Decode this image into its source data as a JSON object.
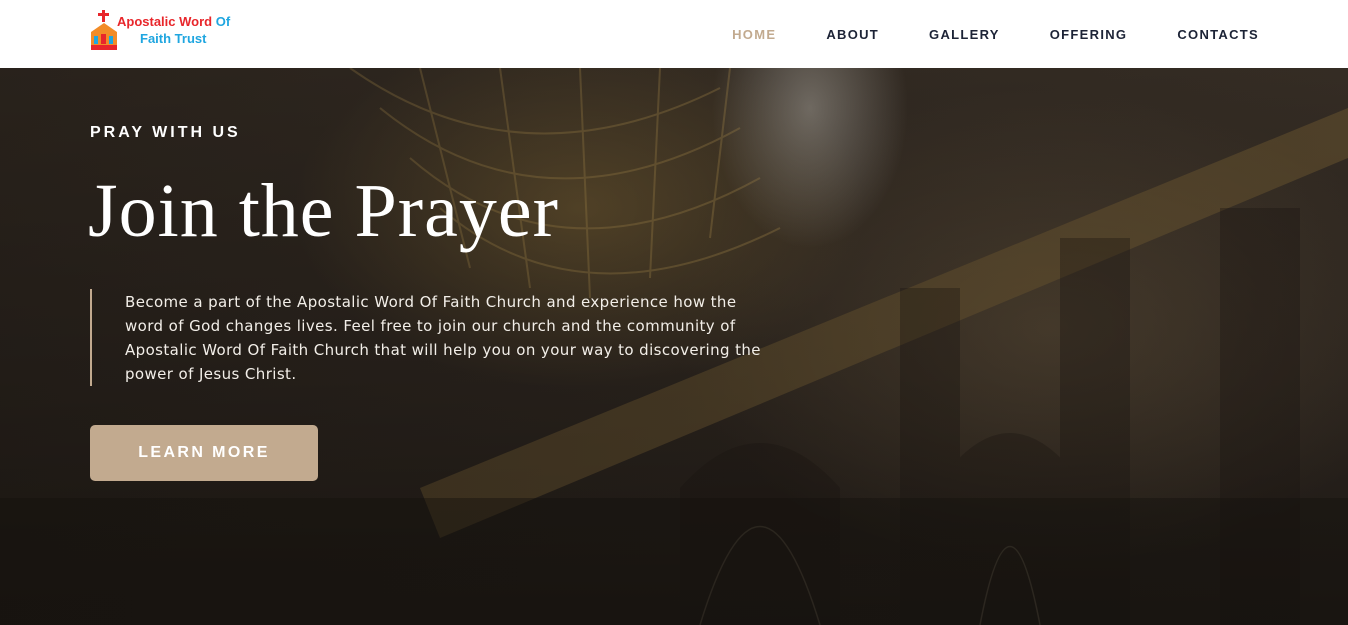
{
  "brand": {
    "line1": "Apostalic Word",
    "line1_of": "Of",
    "line2": "Faith Trust",
    "colors": {
      "red": "#e8262b",
      "blue": "#1fa6e0",
      "orange": "#f28c28"
    }
  },
  "nav": {
    "items": [
      {
        "label": "HOME",
        "active": true
      },
      {
        "label": "ABOUT",
        "active": false
      },
      {
        "label": "GALLERY",
        "active": false
      },
      {
        "label": "OFFERING",
        "active": false
      },
      {
        "label": "CONTACTS",
        "active": false
      }
    ],
    "active_color": "#c2aa8f",
    "text_color": "#1c2336"
  },
  "hero": {
    "eyebrow": "PRAY WITH US",
    "title": "Join the Prayer",
    "description": "Become a part of the Apostalic Word Of Faith Church and experience how the word of God changes lives. Feel free to join our church and the community of Apostalic Word Of Faith Church that will help you on your way to discovering the power of Jesus Christ.",
    "cta_label": "LEARN MORE",
    "accent": "#c2aa8f",
    "background_image": "cathedral-dome-interior"
  }
}
